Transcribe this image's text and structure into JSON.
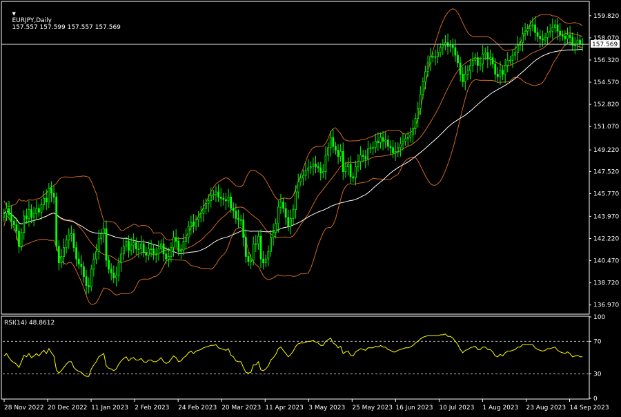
{
  "header": {
    "symbol_label": "EURJPY,Daily",
    "ohlc_text": "157.557 157.599 157.557 157.569",
    "current_price_label": "157.569"
  },
  "rsi_panel": {
    "label": "RSI(14) 48.8612"
  },
  "colors": {
    "background": "#000000",
    "candle_body": "#00ff00",
    "candle_wick": "#00ff00",
    "bollinger": "#d2691e",
    "sma": "#ffffff",
    "rsi_line": "#ffff00",
    "grid_border": "#ffffff",
    "price_tag_bg": "#ffffff",
    "price_tag_text": "#000000"
  },
  "chart_data": {
    "type": "candlestick",
    "price_ticks": [
      "159.820",
      "158.070",
      "156.320",
      "154.570",
      "152.820",
      "151.070",
      "149.220",
      "147.520",
      "145.770",
      "143.970",
      "142.220",
      "140.470",
      "138.720",
      "136.970"
    ],
    "price_ylim": [
      136.3,
      160.9
    ],
    "rsi_ticks": [
      "100",
      "70",
      "30",
      "0"
    ],
    "rsi_levels": [
      70,
      30
    ],
    "rsi_ylim": [
      0,
      100
    ],
    "date_ticks": [
      "28 Nov 2022",
      "20 Dec 2022",
      "11 Jan 2023",
      "2 Feb 2023",
      "24 Feb 2023",
      "20 Mar 2023",
      "11 Apr 2023",
      "3 May 2023",
      "25 May 2023",
      "16 Jun 2023",
      "10 Jul 2023",
      "1 Aug 2023",
      "23 Aug 2023",
      "14 Sep 2023"
    ],
    "current_price": 157.569,
    "close_series": [
      144.2,
      144.6,
      144.1,
      143.6,
      143.3,
      142.8,
      141.6,
      142.7,
      144.0,
      143.8,
      144.5,
      143.9,
      144.2,
      144.6,
      144.3,
      144.9,
      145.4,
      145.1,
      146.2,
      145.8,
      145.5,
      141.6,
      140.3,
      140.8,
      141.5,
      142.1,
      142.5,
      142.6,
      141.5,
      140.6,
      140.2,
      140.0,
      139.2,
      138.5,
      138.4,
      139.8,
      140.6,
      141.2,
      142.2,
      142.6,
      143.0,
      140.5,
      139.8,
      139.5,
      139.1,
      139.3,
      140.3,
      141.0,
      141.6,
      142.0,
      141.3,
      141.7,
      141.9,
      141.4,
      141.4,
      141.8,
      141.1,
      140.9,
      141.4,
      141.4,
      141.0,
      141.0,
      141.4,
      141.8,
      141.0,
      140.6,
      140.8,
      141.5,
      142.3,
      142.0,
      141.2,
      141.3,
      142.0,
      142.3,
      143.2,
      143.5,
      143.2,
      143.7,
      143.9,
      144.2,
      144.6,
      145.0,
      145.2,
      145.6,
      145.7,
      145.9,
      145.5,
      145.4,
      145.3,
      145.2,
      145.5,
      144.6,
      144.4,
      143.8,
      143.7,
      143.7,
      142.3,
      140.8,
      140.4,
      140.5,
      141.8,
      141.8,
      142.4,
      140.6,
      140.3,
      140.6,
      141.2,
      142.3,
      142.7,
      143.4,
      144.7,
      145.1,
      144.6,
      143.9,
      143.2,
      143.8,
      144.5,
      145.9,
      146.7,
      147.0,
      147.2,
      147.6,
      147.8,
      147.9,
      148.1,
      147.9,
      147.8,
      147.4,
      147.5,
      148.8,
      149.4,
      150.2,
      149.5,
      149.2,
      148.7,
      149.1,
      147.5,
      147.9,
      148.1,
      147.1,
      147.0,
      147.9,
      148.3,
      148.8,
      148.7,
      148.5,
      149.3,
      149.4,
      149.4,
      149.9,
      149.8,
      150.2,
      149.9,
      150.0,
      149.5,
      149.4,
      149.0,
      149.1,
      149.4,
      149.7,
      149.9,
      150.1,
      150.2,
      150.4,
      150.9,
      151.7,
      152.5,
      153.6,
      154.6,
      155.4,
      156.1,
      156.6,
      156.6,
      156.6,
      156.9,
      157.3,
      157.5,
      157.7,
      157.4,
      157.5,
      157.3,
      156.7,
      156.1,
      155.2,
      154.6,
      155.2,
      155.5,
      155.9,
      156.3,
      156.5,
      155.9,
      156.0,
      156.8,
      156.9,
      156.4,
      156.5,
      156.0,
      155.2,
      155.0,
      155.5,
      155.2,
      155.9,
      156.3,
      156.3,
      156.7,
      156.9,
      157.5,
      157.7,
      158.4,
      158.6,
      158.8,
      159.0,
      159.1,
      158.5,
      158.2,
      158.0,
      157.9,
      158.1,
      158.5,
      158.6,
      158.9,
      159.1,
      158.6,
      158.3,
      158.2,
      158.0,
      158.3,
      158.1,
      157.5,
      157.6,
      157.9,
      157.6,
      157.6
    ],
    "rsi_series": [
      52,
      55,
      50,
      46,
      44,
      42,
      38,
      45,
      53,
      51,
      55,
      50,
      52,
      55,
      52,
      56,
      59,
      55,
      61,
      56,
      52,
      35,
      31,
      34,
      38,
      42,
      45,
      45,
      38,
      35,
      33,
      32,
      29,
      27,
      27,
      36,
      41,
      45,
      51,
      53,
      55,
      40,
      37,
      36,
      34,
      36,
      42,
      46,
      49,
      51,
      46,
      49,
      50,
      47,
      47,
      49,
      45,
      44,
      47,
      47,
      45,
      45,
      47,
      50,
      45,
      43,
      44,
      48,
      52,
      50,
      45,
      46,
      50,
      52,
      56,
      58,
      55,
      58,
      59,
      60,
      62,
      63,
      64,
      65,
      65,
      66,
      62,
      61,
      60,
      59,
      61,
      53,
      51,
      46,
      45,
      45,
      38,
      32,
      31,
      32,
      41,
      41,
      45,
      35,
      34,
      36,
      40,
      47,
      50,
      54,
      61,
      63,
      59,
      55,
      51,
      54,
      58,
      64,
      67,
      68,
      68,
      69,
      70,
      70,
      71,
      69,
      68,
      65,
      65,
      70,
      72,
      74,
      68,
      66,
      62,
      64,
      55,
      57,
      58,
      53,
      52,
      57,
      59,
      61,
      60,
      59,
      62,
      62,
      62,
      64,
      63,
      65,
      63,
      63,
      60,
      59,
      57,
      57,
      59,
      60,
      61,
      62,
      62,
      63,
      65,
      68,
      70,
      73,
      75,
      76,
      77,
      77,
      77,
      77,
      77,
      78,
      78,
      79,
      76,
      76,
      74,
      70,
      66,
      60,
      56,
      59,
      60,
      62,
      63,
      64,
      60,
      60,
      63,
      63,
      60,
      60,
      57,
      52,
      51,
      54,
      52,
      56,
      58,
      58,
      59,
      60,
      63,
      63,
      66,
      66,
      66,
      66,
      66,
      62,
      60,
      59,
      58,
      59,
      61,
      61,
      62,
      63,
      59,
      57,
      56,
      55,
      57,
      55,
      51,
      52,
      53,
      51,
      51
    ],
    "indicators": [
      "Bollinger Bands",
      "Moving Average",
      "RSI(14)"
    ]
  }
}
